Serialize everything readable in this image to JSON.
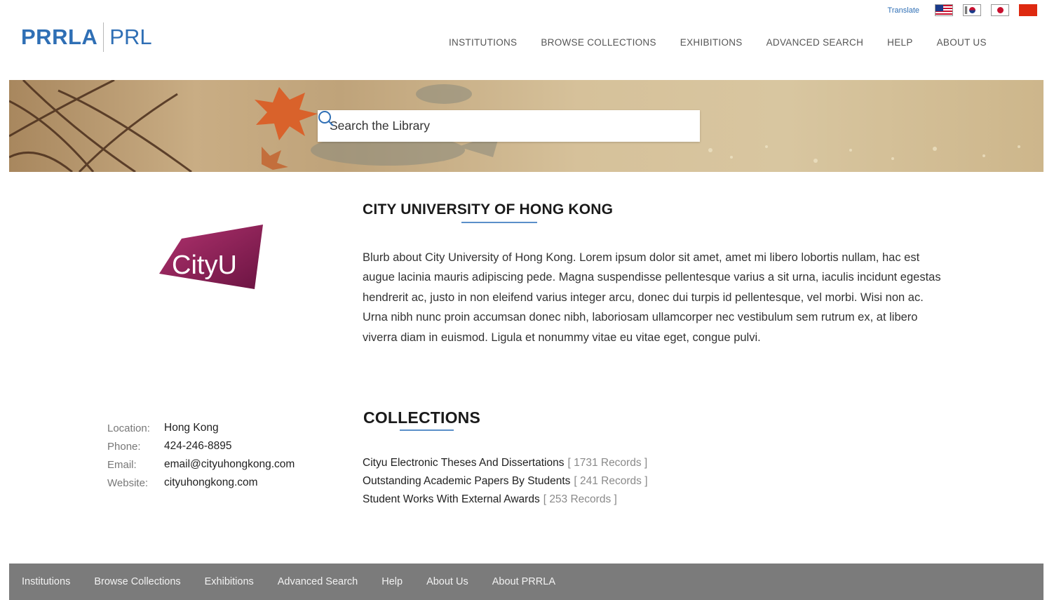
{
  "utility": {
    "translate_label": "Translate",
    "flags": [
      "us-flag-icon",
      "korea-flag-icon",
      "japan-flag-icon",
      "china-flag-icon"
    ]
  },
  "header": {
    "logo_primary": "PRRLA",
    "logo_secondary": "PRL",
    "nav": [
      "INSTITUTIONS",
      "BROWSE COLLECTIONS",
      "EXHIBITIONS",
      "ADVANCED SEARCH",
      "HELP",
      "ABOUT US"
    ]
  },
  "search": {
    "placeholder": "Search the Library",
    "icon": "search-icon"
  },
  "institution": {
    "logo_text": "CityU",
    "title": "CITY UNIVERSITY OF HONG KONG",
    "blurb": "Blurb about City University of Hong Kong. Lorem ipsum dolor sit amet, amet mi libero lobortis nullam, hac est augue lacinia mauris adipiscing pede. Magna suspendisse pellentesque varius a sit urna, iaculis incidunt egestas hendrerit ac, justo in non eleifend varius integer arcu, donec dui turpis id pellentesque, vel morbi. Wisi non ac. Urna nibh nunc proin accumsan donec nibh, laboriosam ullamcorper nec vestibulum sem rutrum ex, at libero viverra diam in euismod. Ligula et nonummy vitae eu vitae eget, congue pulvi.",
    "contact": [
      {
        "label": "Location:",
        "value": "Hong Kong"
      },
      {
        "label": "Phone:",
        "value": "424-246-8895"
      },
      {
        "label": "Email:",
        "value": "email@cityuhongkong.com"
      },
      {
        "label": "Website:",
        "value": "cityuhongkong.com"
      }
    ]
  },
  "collections": {
    "title": "COLLECTIONS",
    "items": [
      {
        "name": "Cityu Electronic Theses And Dissertations",
        "count": "[ 1731 Records ]"
      },
      {
        "name": "Outstanding Academic Papers By Students",
        "count": "[ 241 Records ]"
      },
      {
        "name": "Student Works With External Awards",
        "count": "[ 253 Records ]"
      }
    ]
  },
  "footer": {
    "links": [
      "Institutions",
      "Browse Collections",
      "Exhibitions",
      "Advanced Search",
      "Help",
      "About Us",
      "About PRRLA"
    ]
  },
  "colors": {
    "brand_blue": "#2f6fb5",
    "accent_rule": "#5a8fc9",
    "footer_bg": "#7b7b7b",
    "cityu_magenta": "#8c1d5a"
  }
}
